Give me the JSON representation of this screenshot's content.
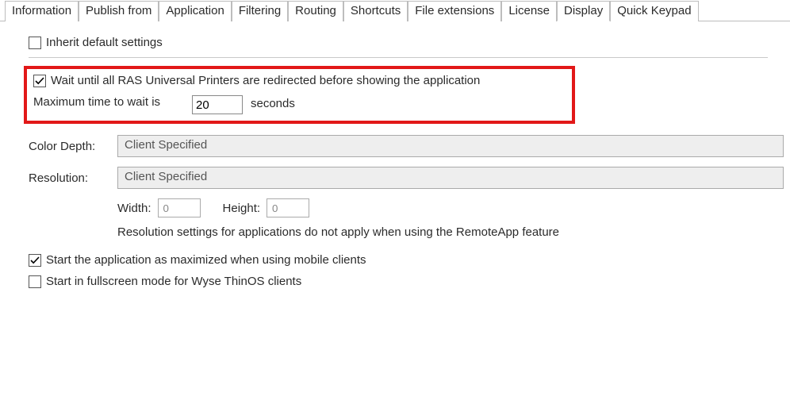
{
  "tabs": {
    "items": [
      {
        "label": "Information"
      },
      {
        "label": "Publish from"
      },
      {
        "label": "Application"
      },
      {
        "label": "Filtering"
      },
      {
        "label": "Routing"
      },
      {
        "label": "Shortcuts"
      },
      {
        "label": "File extensions"
      },
      {
        "label": "License"
      },
      {
        "label": "Display"
      },
      {
        "label": "Quick Keypad"
      }
    ],
    "active_index": 8
  },
  "inherit": {
    "label": "Inherit default settings",
    "checked": false
  },
  "wait": {
    "enabled_label": "Wait until all RAS Universal Printers are redirected before showing the application",
    "checked": true,
    "maxlabel": "Maximum time to wait is",
    "value": "20",
    "unit": "seconds"
  },
  "color_depth": {
    "label": "Color Depth:",
    "value": "Client Specified"
  },
  "resolution": {
    "label": "Resolution:",
    "value": "Client Specified"
  },
  "dims": {
    "width_label": "Width:",
    "width_value": "0",
    "height_label": "Height:",
    "height_value": "0"
  },
  "hint": "Resolution settings for applications do not apply when using the RemoteApp feature",
  "maximized": {
    "label": "Start the application as maximized when using mobile clients",
    "checked": true
  },
  "fullscreen": {
    "label": "Start in fullscreen mode for Wyse ThinOS clients",
    "checked": false
  }
}
